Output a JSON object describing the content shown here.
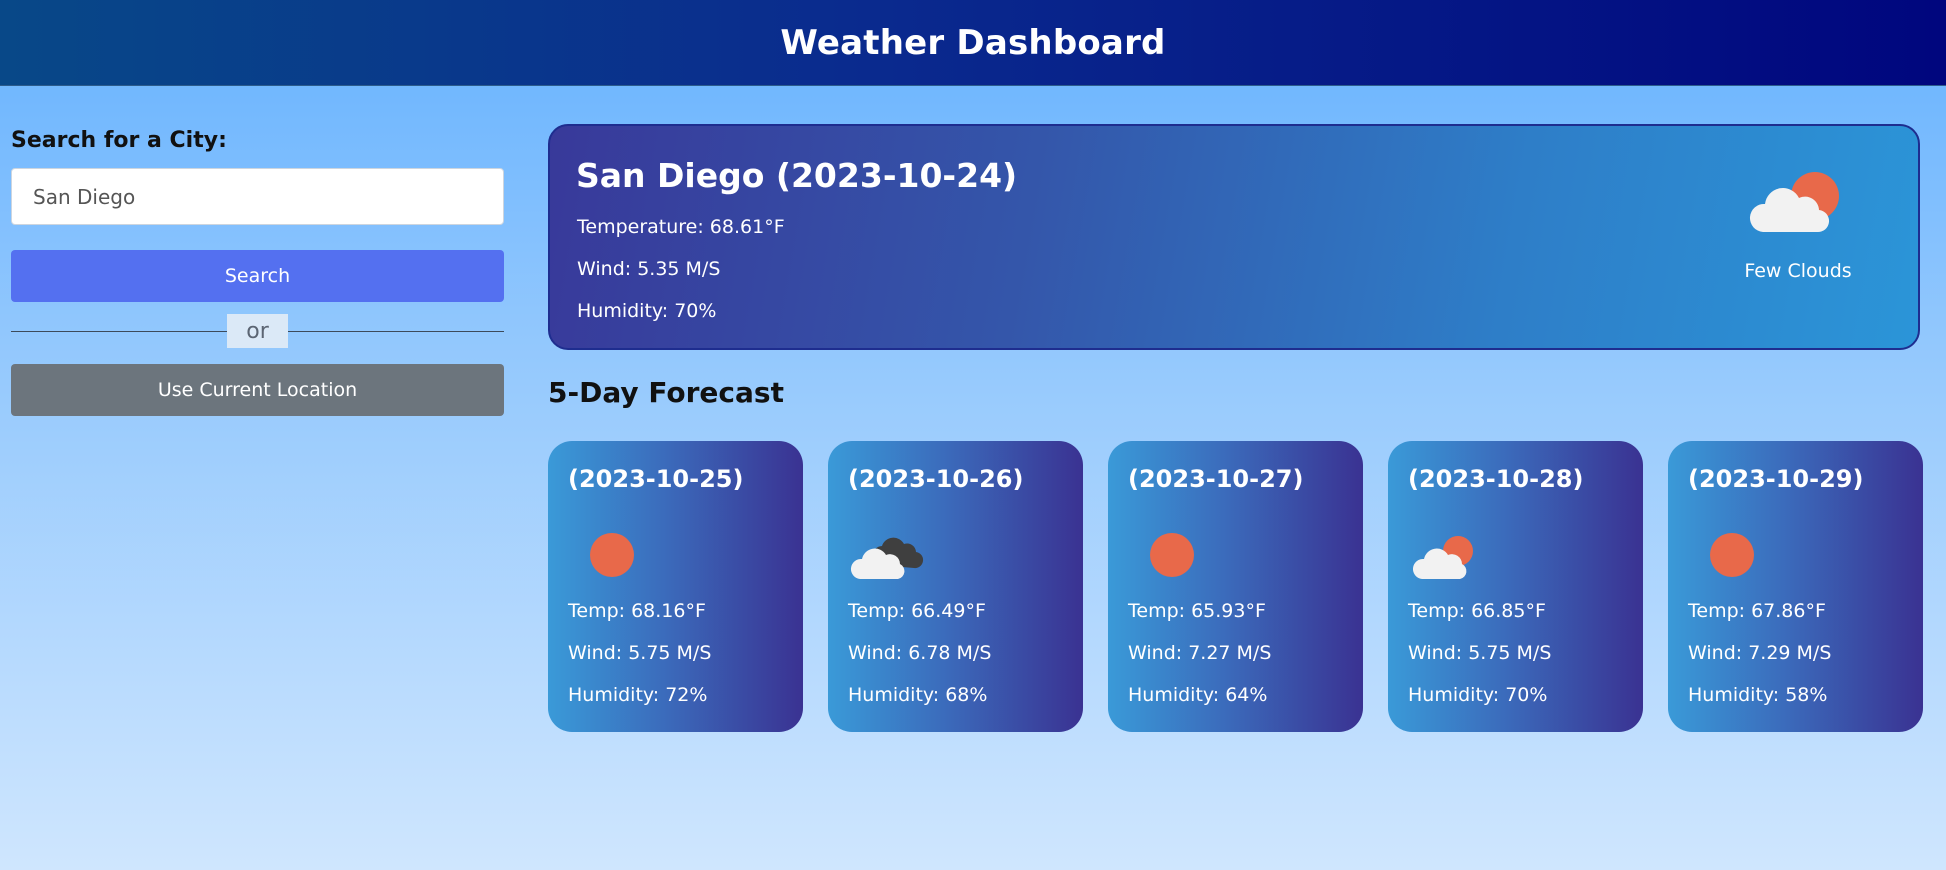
{
  "header": {
    "title": "Weather Dashboard"
  },
  "search": {
    "label": "Search for a City:",
    "input_value": "San Diego",
    "search_button": "Search",
    "or_text": "or",
    "location_button": "Use Current Location"
  },
  "current": {
    "title": "San Diego (2023-10-24)",
    "temperature": "Temperature: 68.61°F",
    "wind": "Wind: 5.35 M/S",
    "humidity": "Humidity: 70%",
    "condition": "Few Clouds",
    "icon": "few-clouds-icon"
  },
  "forecast": {
    "title": "5-Day Forecast",
    "days": [
      {
        "date": "(2023-10-25)",
        "icon": "clear-sun-icon",
        "temp": "Temp: 68.16°F",
        "wind": "Wind: 5.75 M/S",
        "humidity": "Humidity: 72%"
      },
      {
        "date": "(2023-10-26)",
        "icon": "broken-clouds-icon",
        "temp": "Temp: 66.49°F",
        "wind": "Wind: 6.78 M/S",
        "humidity": "Humidity: 68%"
      },
      {
        "date": "(2023-10-27)",
        "icon": "clear-sun-icon",
        "temp": "Temp: 65.93°F",
        "wind": "Wind: 7.27 M/S",
        "humidity": "Humidity: 64%"
      },
      {
        "date": "(2023-10-28)",
        "icon": "few-clouds-icon",
        "temp": "Temp: 66.85°F",
        "wind": "Wind: 5.75 M/S",
        "humidity": "Humidity: 70%"
      },
      {
        "date": "(2023-10-29)",
        "icon": "clear-sun-icon",
        "temp": "Temp: 67.86°F",
        "wind": "Wind: 7.29 M/S",
        "humidity": "Humidity: 58%"
      }
    ]
  },
  "colors": {
    "sun": "#e8694a",
    "cloud": "#f2f2f2",
    "dark_cloud": "#3f3f3f",
    "search_button": "#5470f0",
    "location_button": "#6c757d"
  }
}
